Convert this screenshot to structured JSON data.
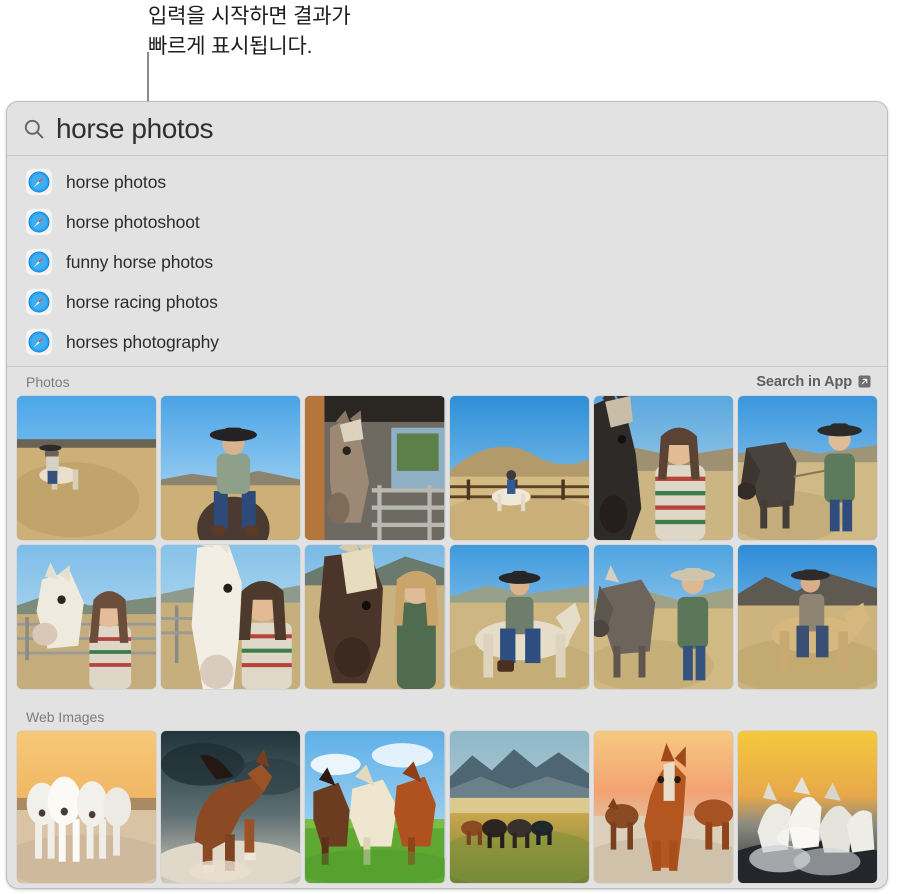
{
  "callout": {
    "text": "입력을 시작하면 결과가\n빠르게 표시됩니다."
  },
  "search": {
    "icon": "search-icon",
    "value": "horse photos",
    "placeholder": "Search"
  },
  "suggestions": {
    "icon": "safari-compass-icon",
    "items": [
      {
        "label": "horse photos"
      },
      {
        "label": "horse photoshoot"
      },
      {
        "label": "funny horse photos"
      },
      {
        "label": "horse racing photos"
      },
      {
        "label": "horses photography"
      }
    ]
  },
  "sections": [
    {
      "title": "Photos",
      "action_label": "Search in App",
      "action_icon": "arrow-up-right-box-icon",
      "rows": [
        [
          {
            "alt": "girl riding cream horse on dry golden hillside"
          },
          {
            "alt": "girl in black cowboy hat riding dark horse"
          },
          {
            "alt": "tan horse head in barn stall behind metal gate"
          },
          {
            "alt": "white horse and rider in open field with fence"
          },
          {
            "alt": "close-up dark horse head beside girl in striped sweater"
          },
          {
            "alt": "dark horse grazing beside girl in cowboy hat holding lead"
          }
        ],
        [
          {
            "alt": "white horse nuzzling smiling girl near corral fence"
          },
          {
            "alt": "girl embracing white horse head in paddock"
          },
          {
            "alt": "dark brown horse with blonde mane beside blonde girl"
          },
          {
            "alt": "girl riding light horse across dry field"
          },
          {
            "alt": "girl in straw hat standing with dark horse in field"
          },
          {
            "alt": "rider on buckskin horse with mountains behind"
          }
        ]
      ]
    },
    {
      "title": "Web Images",
      "rows": [
        [
          {
            "alt": "herd of white horses galloping through shallow water at sunset"
          },
          {
            "alt": "chestnut horse galloping in dust under stormy sky"
          },
          {
            "alt": "three horses running in green grass field under blue sky"
          },
          {
            "alt": "wild horses on steppe with mountain range at dusk"
          },
          {
            "alt": "brown horses standing on beach at orange sunset"
          },
          {
            "alt": "white horses splashing through water at golden sunrise"
          }
        ]
      ]
    }
  ],
  "colors": {
    "panel_background": "#e2e2e2",
    "panel_border": "#bdbdbd",
    "search_text": "#303030",
    "suggestion_text": "#2c2c2e",
    "section_title": "#7c7c80",
    "section_action": "#5e5e62",
    "callout_text": "#1d1d1f",
    "callout_line": "#8b8b8f"
  }
}
